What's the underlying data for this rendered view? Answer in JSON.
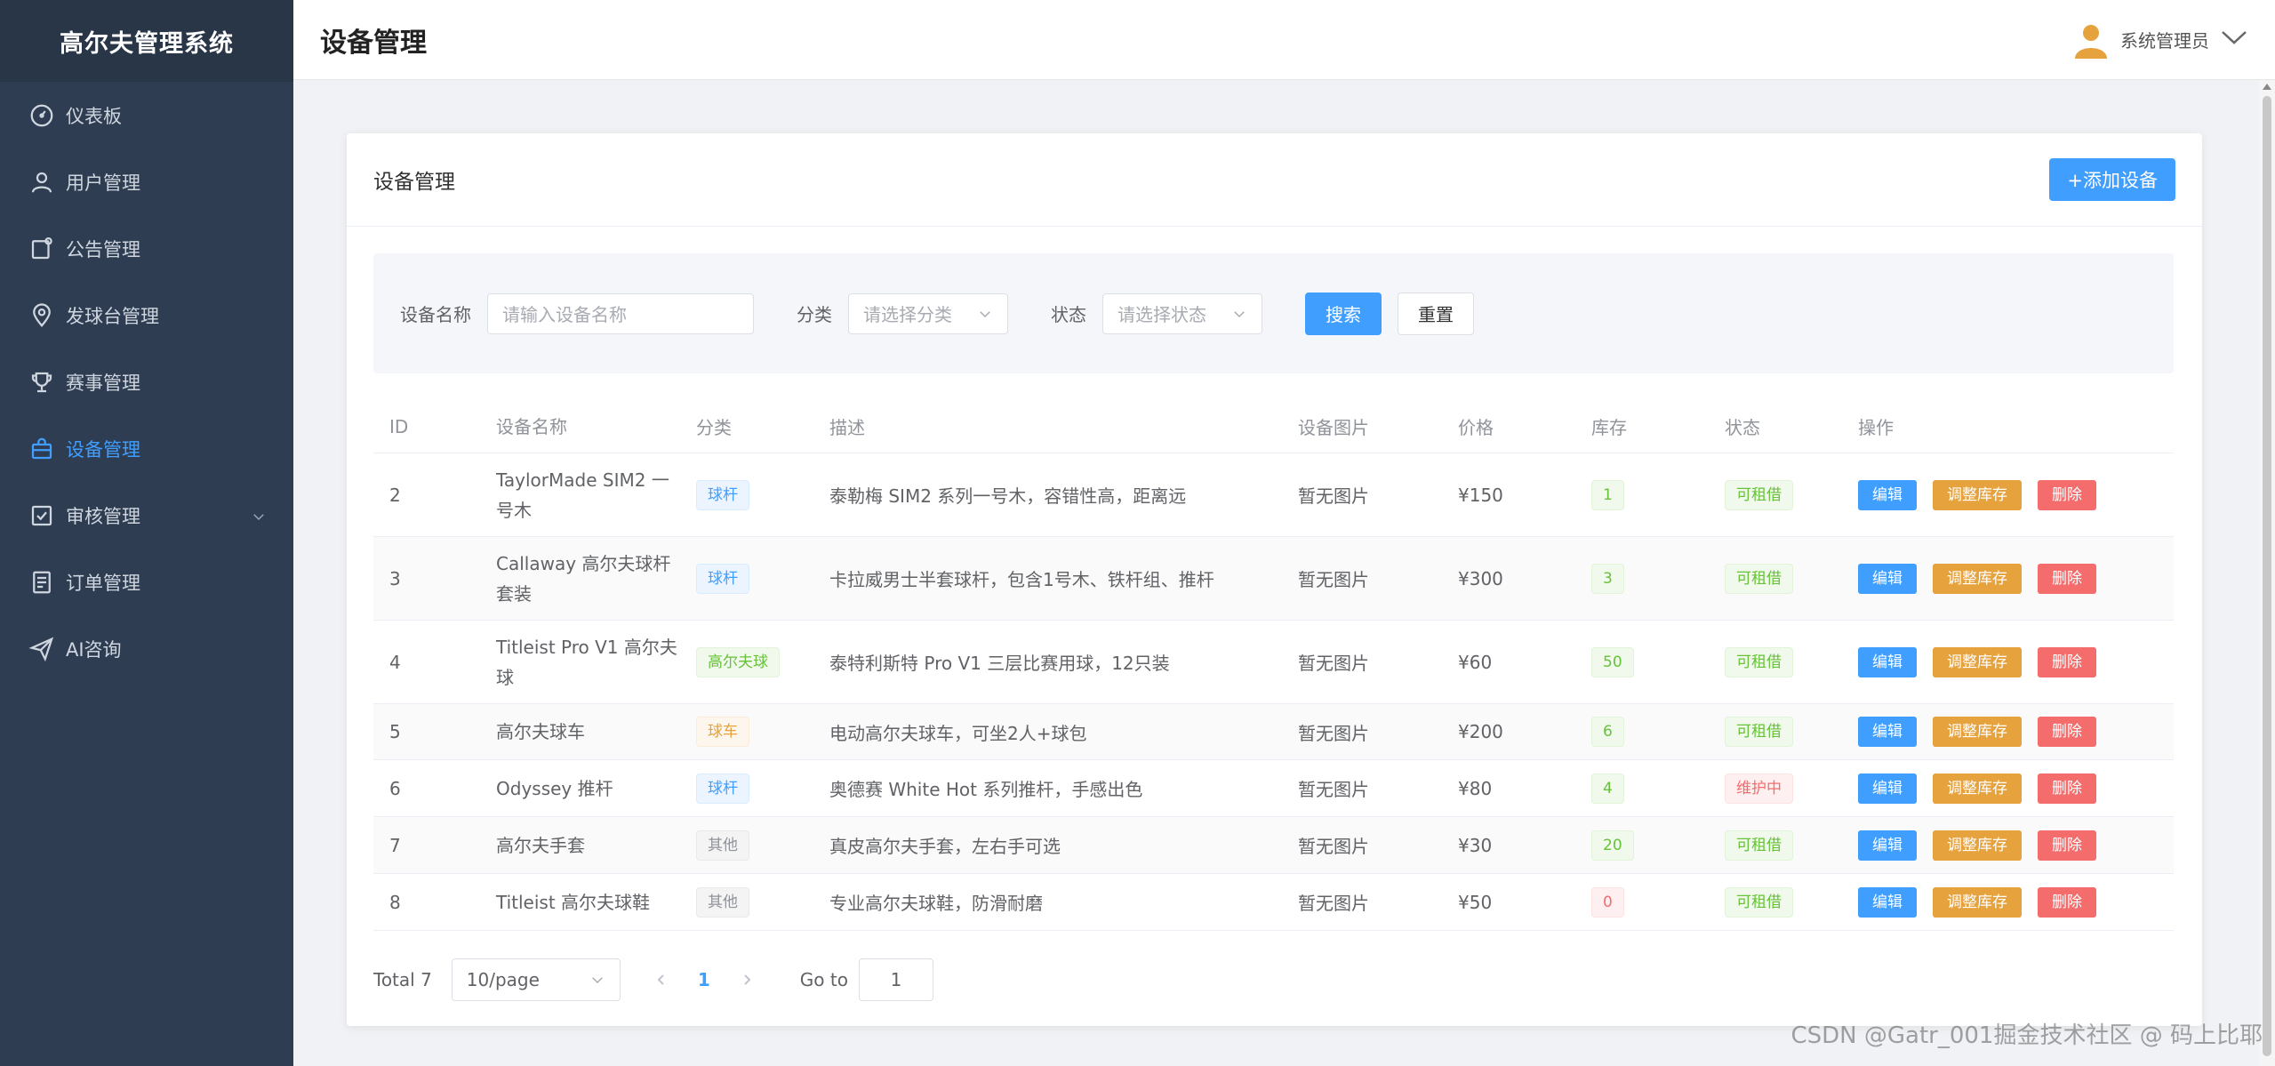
{
  "brand": "高尔夫管理系统",
  "sidebar": {
    "items": [
      {
        "label": "仪表板",
        "icon": "dashboard-icon"
      },
      {
        "label": "用户管理",
        "icon": "user-icon"
      },
      {
        "label": "公告管理",
        "icon": "notice-icon"
      },
      {
        "label": "发球台管理",
        "icon": "location-icon"
      },
      {
        "label": "赛事管理",
        "icon": "trophy-icon"
      },
      {
        "label": "设备管理",
        "icon": "bag-icon"
      },
      {
        "label": "审核管理",
        "icon": "audit-icon"
      },
      {
        "label": "订单管理",
        "icon": "order-icon"
      },
      {
        "label": "AI咨询",
        "icon": "send-icon"
      }
    ]
  },
  "header": {
    "title": "设备管理",
    "user": "系统管理员"
  },
  "card": {
    "title": "设备管理",
    "add_button": "+添加设备"
  },
  "filter": {
    "name_label": "设备名称",
    "name_placeholder": "请输入设备名称",
    "category_label": "分类",
    "category_placeholder": "请选择分类",
    "status_label": "状态",
    "status_placeholder": "请选择状态",
    "search_button": "搜索",
    "reset_button": "重置"
  },
  "table": {
    "columns": {
      "id": "ID",
      "name": "设备名称",
      "category": "分类",
      "desc": "描述",
      "image": "设备图片",
      "price": "价格",
      "stock": "库存",
      "status": "状态",
      "ops": "操作"
    },
    "rows": [
      {
        "id": "2",
        "name": "TaylorMade SIM2 一号木",
        "category": "球杆",
        "desc": "泰勒梅 SIM2 系列一号木，容错性高，距离远",
        "image": "暂无图片",
        "price": "¥150",
        "stock": "1",
        "status": "可租借"
      },
      {
        "id": "3",
        "name": "Callaway 高尔夫球杆套装",
        "category": "球杆",
        "desc": "卡拉威男士半套球杆，包含1号木、铁杆组、推杆",
        "image": "暂无图片",
        "price": "¥300",
        "stock": "3",
        "status": "可租借"
      },
      {
        "id": "4",
        "name": "Titleist Pro V1 高尔夫球",
        "category": "高尔夫球",
        "desc": "泰特利斯特 Pro V1 三层比赛用球，12只装",
        "image": "暂无图片",
        "price": "¥60",
        "stock": "50",
        "status": "可租借"
      },
      {
        "id": "5",
        "name": "高尔夫球车",
        "category": "球车",
        "desc": "电动高尔夫球车，可坐2人+球包",
        "image": "暂无图片",
        "price": "¥200",
        "stock": "6",
        "status": "可租借"
      },
      {
        "id": "6",
        "name": "Odyssey 推杆",
        "category": "球杆",
        "desc": "奥德赛 White Hot 系列推杆，手感出色",
        "image": "暂无图片",
        "price": "¥80",
        "stock": "4",
        "status": "维护中"
      },
      {
        "id": "7",
        "name": "高尔夫手套",
        "category": "其他",
        "desc": "真皮高尔夫手套，左右手可选",
        "image": "暂无图片",
        "price": "¥30",
        "stock": "20",
        "status": "可租借"
      },
      {
        "id": "8",
        "name": "Titleist 高尔夫球鞋",
        "category": "其他",
        "desc": "专业高尔夫球鞋，防滑耐磨",
        "image": "暂无图片",
        "price": "¥50",
        "stock": "0",
        "status": "可租借"
      }
    ],
    "ops": {
      "edit": "编辑",
      "adjust": "调整库存",
      "delete": "删除"
    }
  },
  "pagination": {
    "total": "Total 7",
    "page_size": "10/page",
    "current_page": "1",
    "goto_label": "Go to",
    "goto_value": "1"
  },
  "watermark": "CSDN @Gatr_001掘金技术社区 @ 码上比耶",
  "colors": {
    "primary": "#409eff",
    "sidebar_bg": "#2e3d52",
    "warning": "#e6a23c",
    "danger": "#f56c6c",
    "success": "#67c23a"
  }
}
